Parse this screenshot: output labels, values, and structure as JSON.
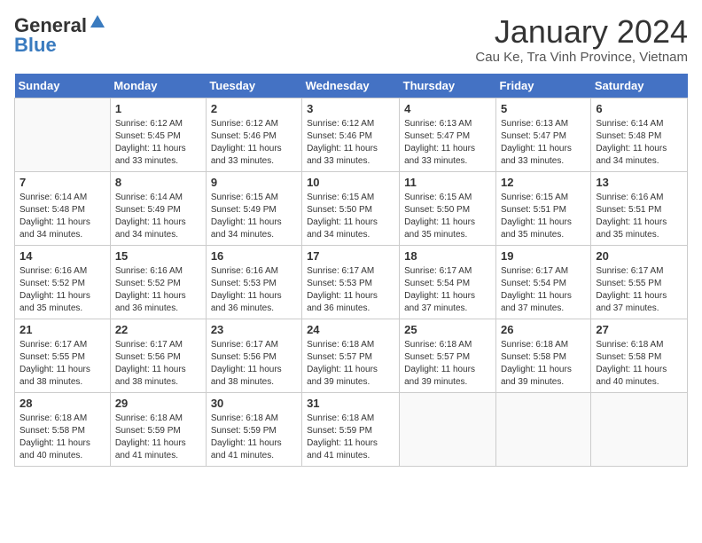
{
  "logo": {
    "general": "General",
    "blue": "Blue"
  },
  "title": "January 2024",
  "location": "Cau Ke, Tra Vinh Province, Vietnam",
  "days": [
    "Sunday",
    "Monday",
    "Tuesday",
    "Wednesday",
    "Thursday",
    "Friday",
    "Saturday"
  ],
  "weeks": [
    [
      {
        "day": "",
        "content": ""
      },
      {
        "day": "1",
        "content": "Sunrise: 6:12 AM\nSunset: 5:45 PM\nDaylight: 11 hours\nand 33 minutes."
      },
      {
        "day": "2",
        "content": "Sunrise: 6:12 AM\nSunset: 5:46 PM\nDaylight: 11 hours\nand 33 minutes."
      },
      {
        "day": "3",
        "content": "Sunrise: 6:12 AM\nSunset: 5:46 PM\nDaylight: 11 hours\nand 33 minutes."
      },
      {
        "day": "4",
        "content": "Sunrise: 6:13 AM\nSunset: 5:47 PM\nDaylight: 11 hours\nand 33 minutes."
      },
      {
        "day": "5",
        "content": "Sunrise: 6:13 AM\nSunset: 5:47 PM\nDaylight: 11 hours\nand 33 minutes."
      },
      {
        "day": "6",
        "content": "Sunrise: 6:14 AM\nSunset: 5:48 PM\nDaylight: 11 hours\nand 34 minutes."
      }
    ],
    [
      {
        "day": "7",
        "content": "Sunrise: 6:14 AM\nSunset: 5:48 PM\nDaylight: 11 hours\nand 34 minutes."
      },
      {
        "day": "8",
        "content": "Sunrise: 6:14 AM\nSunset: 5:49 PM\nDaylight: 11 hours\nand 34 minutes."
      },
      {
        "day": "9",
        "content": "Sunrise: 6:15 AM\nSunset: 5:49 PM\nDaylight: 11 hours\nand 34 minutes."
      },
      {
        "day": "10",
        "content": "Sunrise: 6:15 AM\nSunset: 5:50 PM\nDaylight: 11 hours\nand 34 minutes."
      },
      {
        "day": "11",
        "content": "Sunrise: 6:15 AM\nSunset: 5:50 PM\nDaylight: 11 hours\nand 35 minutes."
      },
      {
        "day": "12",
        "content": "Sunrise: 6:15 AM\nSunset: 5:51 PM\nDaylight: 11 hours\nand 35 minutes."
      },
      {
        "day": "13",
        "content": "Sunrise: 6:16 AM\nSunset: 5:51 PM\nDaylight: 11 hours\nand 35 minutes."
      }
    ],
    [
      {
        "day": "14",
        "content": "Sunrise: 6:16 AM\nSunset: 5:52 PM\nDaylight: 11 hours\nand 35 minutes."
      },
      {
        "day": "15",
        "content": "Sunrise: 6:16 AM\nSunset: 5:52 PM\nDaylight: 11 hours\nand 36 minutes."
      },
      {
        "day": "16",
        "content": "Sunrise: 6:16 AM\nSunset: 5:53 PM\nDaylight: 11 hours\nand 36 minutes."
      },
      {
        "day": "17",
        "content": "Sunrise: 6:17 AM\nSunset: 5:53 PM\nDaylight: 11 hours\nand 36 minutes."
      },
      {
        "day": "18",
        "content": "Sunrise: 6:17 AM\nSunset: 5:54 PM\nDaylight: 11 hours\nand 37 minutes."
      },
      {
        "day": "19",
        "content": "Sunrise: 6:17 AM\nSunset: 5:54 PM\nDaylight: 11 hours\nand 37 minutes."
      },
      {
        "day": "20",
        "content": "Sunrise: 6:17 AM\nSunset: 5:55 PM\nDaylight: 11 hours\nand 37 minutes."
      }
    ],
    [
      {
        "day": "21",
        "content": "Sunrise: 6:17 AM\nSunset: 5:55 PM\nDaylight: 11 hours\nand 38 minutes."
      },
      {
        "day": "22",
        "content": "Sunrise: 6:17 AM\nSunset: 5:56 PM\nDaylight: 11 hours\nand 38 minutes."
      },
      {
        "day": "23",
        "content": "Sunrise: 6:17 AM\nSunset: 5:56 PM\nDaylight: 11 hours\nand 38 minutes."
      },
      {
        "day": "24",
        "content": "Sunrise: 6:18 AM\nSunset: 5:57 PM\nDaylight: 11 hours\nand 39 minutes."
      },
      {
        "day": "25",
        "content": "Sunrise: 6:18 AM\nSunset: 5:57 PM\nDaylight: 11 hours\nand 39 minutes."
      },
      {
        "day": "26",
        "content": "Sunrise: 6:18 AM\nSunset: 5:58 PM\nDaylight: 11 hours\nand 39 minutes."
      },
      {
        "day": "27",
        "content": "Sunrise: 6:18 AM\nSunset: 5:58 PM\nDaylight: 11 hours\nand 40 minutes."
      }
    ],
    [
      {
        "day": "28",
        "content": "Sunrise: 6:18 AM\nSunset: 5:58 PM\nDaylight: 11 hours\nand 40 minutes."
      },
      {
        "day": "29",
        "content": "Sunrise: 6:18 AM\nSunset: 5:59 PM\nDaylight: 11 hours\nand 41 minutes."
      },
      {
        "day": "30",
        "content": "Sunrise: 6:18 AM\nSunset: 5:59 PM\nDaylight: 11 hours\nand 41 minutes."
      },
      {
        "day": "31",
        "content": "Sunrise: 6:18 AM\nSunset: 5:59 PM\nDaylight: 11 hours\nand 41 minutes."
      },
      {
        "day": "",
        "content": ""
      },
      {
        "day": "",
        "content": ""
      },
      {
        "day": "",
        "content": ""
      }
    ]
  ]
}
